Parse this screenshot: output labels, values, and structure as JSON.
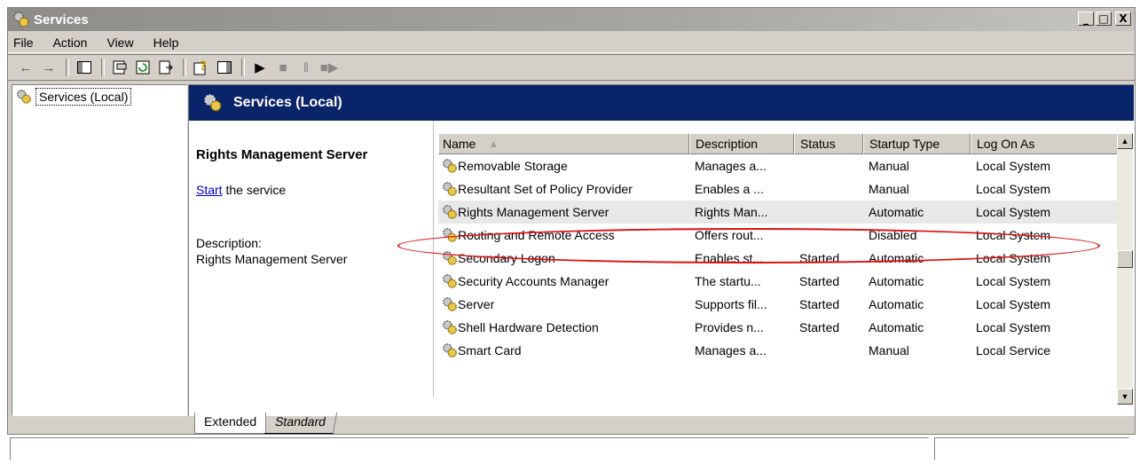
{
  "window": {
    "title": "Services",
    "controls": [
      "_",
      "□",
      "X"
    ]
  },
  "menu": [
    {
      "label": "File"
    },
    {
      "label": "Action"
    },
    {
      "label": "View"
    },
    {
      "label": "Help"
    }
  ],
  "toolbar": {
    "icons": [
      "back-icon",
      "forward-icon",
      "show-hide-tree-icon",
      "properties-icon",
      "refresh-icon",
      "export-list-icon",
      "help-icon",
      "show-hide-action-pane-icon",
      "start-service-icon",
      "stop-service-icon",
      "pause-service-icon",
      "restart-service-icon"
    ]
  },
  "tree": {
    "root_label": "Services (Local)"
  },
  "banner": {
    "title": "Services (Local)"
  },
  "details": {
    "service_name": "Rights Management Server",
    "start_link": "Start",
    "start_suffix": " the service",
    "description_label": "Description:",
    "description_value": "Rights Management Server"
  },
  "table": {
    "columns": [
      "Name",
      "Description",
      "Status",
      "Startup Type",
      "Log On As"
    ],
    "sort_indicator": "▲",
    "rows": [
      {
        "name": "Removable Storage",
        "description": "Manages a...",
        "status": "",
        "startup": "Manual",
        "logon": "Local System"
      },
      {
        "name": "Resultant Set of Policy Provider",
        "description": "Enables a ...",
        "status": "",
        "startup": "Manual",
        "logon": "Local System"
      },
      {
        "name": "Rights Management Server",
        "description": "Rights Man...",
        "status": "",
        "startup": "Automatic",
        "logon": "Local System",
        "selected": true
      },
      {
        "name": "Routing and Remote Access",
        "description": "Offers rout...",
        "status": "",
        "startup": "Disabled",
        "logon": "Local System"
      },
      {
        "name": "Secondary Logon",
        "description": "Enables st...",
        "status": "Started",
        "startup": "Automatic",
        "logon": "Local System"
      },
      {
        "name": "Security Accounts Manager",
        "description": "The startu...",
        "status": "Started",
        "startup": "Automatic",
        "logon": "Local System"
      },
      {
        "name": "Server",
        "description": "Supports fil...",
        "status": "Started",
        "startup": "Automatic",
        "logon": "Local System"
      },
      {
        "name": "Shell Hardware Detection",
        "description": "Provides n...",
        "status": "Started",
        "startup": "Automatic",
        "logon": "Local System"
      },
      {
        "name": "Smart Card",
        "description": "Manages a...",
        "status": "",
        "startup": "Manual",
        "logon": "Local Service"
      }
    ]
  },
  "tabs": [
    "Extended",
    "Standard"
  ],
  "colors": {
    "banner": "#0a246a",
    "highlight": "#e01010",
    "link": "#0000cc"
  }
}
